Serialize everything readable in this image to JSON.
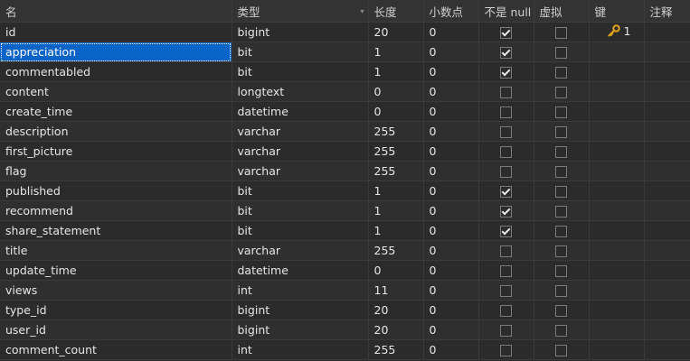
{
  "columns": {
    "name": "名",
    "type": "类型",
    "length": "长度",
    "decimals": "小数点",
    "not_null": "不是 null",
    "virtual": "虚拟",
    "key": "键",
    "comment": "注释"
  },
  "rows": [
    {
      "name": "id",
      "type": "bigint",
      "length": "20",
      "decimals": "0",
      "not_null": true,
      "virtual": false,
      "key": "1",
      "selected": false
    },
    {
      "name": "appreciation",
      "type": "bit",
      "length": "1",
      "decimals": "0",
      "not_null": true,
      "virtual": false,
      "key": "",
      "selected": true
    },
    {
      "name": "commentabled",
      "type": "bit",
      "length": "1",
      "decimals": "0",
      "not_null": true,
      "virtual": false,
      "key": "",
      "selected": false
    },
    {
      "name": "content",
      "type": "longtext",
      "length": "0",
      "decimals": "0",
      "not_null": false,
      "virtual": false,
      "key": "",
      "selected": false
    },
    {
      "name": "create_time",
      "type": "datetime",
      "length": "0",
      "decimals": "0",
      "not_null": false,
      "virtual": false,
      "key": "",
      "selected": false
    },
    {
      "name": "description",
      "type": "varchar",
      "length": "255",
      "decimals": "0",
      "not_null": false,
      "virtual": false,
      "key": "",
      "selected": false
    },
    {
      "name": "first_picture",
      "type": "varchar",
      "length": "255",
      "decimals": "0",
      "not_null": false,
      "virtual": false,
      "key": "",
      "selected": false
    },
    {
      "name": "flag",
      "type": "varchar",
      "length": "255",
      "decimals": "0",
      "not_null": false,
      "virtual": false,
      "key": "",
      "selected": false
    },
    {
      "name": "published",
      "type": "bit",
      "length": "1",
      "decimals": "0",
      "not_null": true,
      "virtual": false,
      "key": "",
      "selected": false
    },
    {
      "name": "recommend",
      "type": "bit",
      "length": "1",
      "decimals": "0",
      "not_null": true,
      "virtual": false,
      "key": "",
      "selected": false
    },
    {
      "name": "share_statement",
      "type": "bit",
      "length": "1",
      "decimals": "0",
      "not_null": true,
      "virtual": false,
      "key": "",
      "selected": false
    },
    {
      "name": "title",
      "type": "varchar",
      "length": "255",
      "decimals": "0",
      "not_null": false,
      "virtual": false,
      "key": "",
      "selected": false
    },
    {
      "name": "update_time",
      "type": "datetime",
      "length": "0",
      "decimals": "0",
      "not_null": false,
      "virtual": false,
      "key": "",
      "selected": false
    },
    {
      "name": "views",
      "type": "int",
      "length": "11",
      "decimals": "0",
      "not_null": false,
      "virtual": false,
      "key": "",
      "selected": false
    },
    {
      "name": "type_id",
      "type": "bigint",
      "length": "20",
      "decimals": "0",
      "not_null": false,
      "virtual": false,
      "key": "",
      "selected": false
    },
    {
      "name": "user_id",
      "type": "bigint",
      "length": "20",
      "decimals": "0",
      "not_null": false,
      "virtual": false,
      "key": "",
      "selected": false
    },
    {
      "name": "comment_count",
      "type": "int",
      "length": "255",
      "decimals": "0",
      "not_null": false,
      "virtual": false,
      "key": "",
      "selected": false
    }
  ],
  "icons": {
    "primary_key": "key-icon",
    "sort": "sort-arrow-icon"
  },
  "colors": {
    "selection": "#0a63c7",
    "key_icon": "#e0a21b"
  }
}
